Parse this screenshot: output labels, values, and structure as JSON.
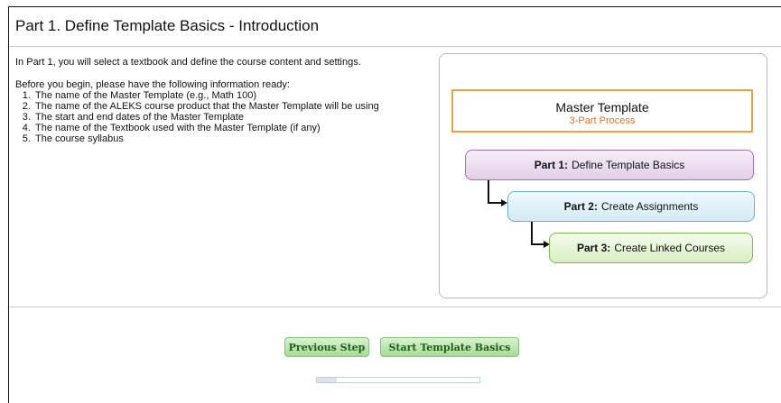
{
  "page": {
    "title": "Part 1. Define Template Basics - Introduction",
    "intro": "In Part 1, you will select a textbook and define the course content and settings.",
    "before_heading": "Before you begin, please have the following information ready:",
    "checklist": [
      "The name of the Master Template (e.g., Math 100)",
      "The name of the ALEKS course product that the Master Template will be using",
      "The start and end dates of the Master Template",
      "The name of the Textbook used with the Master Template (if any)",
      "The course syllabus"
    ]
  },
  "diagram": {
    "title": "Master Template",
    "subtitle": "3-Part Process",
    "parts": [
      {
        "label": "Part 1:",
        "text": "Define Template Basics"
      },
      {
        "label": "Part 2:",
        "text": "Create Assignments"
      },
      {
        "label": "Part 3:",
        "text": "Create Linked Courses"
      }
    ]
  },
  "buttons": {
    "previous": "Previous Step",
    "start": "Start Template Basics"
  },
  "progress": {
    "value": 0.12
  }
}
